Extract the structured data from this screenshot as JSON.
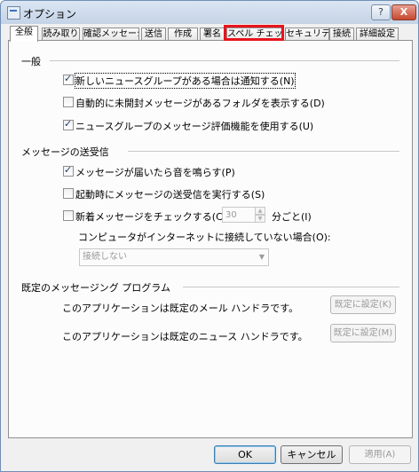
{
  "window": {
    "title": "オプション",
    "help_label": "?",
    "close_label": "X"
  },
  "tabs": [
    {
      "label": "全般"
    },
    {
      "label": "読み取り"
    },
    {
      "label": "確認メッセージ"
    },
    {
      "label": "送信"
    },
    {
      "label": "作成"
    },
    {
      "label": "署名"
    },
    {
      "label": "スペル チェック"
    },
    {
      "label": "セキュリティ"
    },
    {
      "label": "接続"
    },
    {
      "label": "詳細設定"
    }
  ],
  "general": {
    "heading": "一般",
    "options": [
      {
        "label": "新しいニュースグループがある場合は通知する(N)",
        "checked": true
      },
      {
        "label": "自動的に未開封メッセージがあるフォルダを表示する(D)",
        "checked": false
      },
      {
        "label": "ニュースグループのメッセージ評価機能を使用する(U)",
        "checked": true
      }
    ]
  },
  "send_receive": {
    "heading": "メッセージの送受信",
    "options": [
      {
        "label": "メッセージが届いたら音を鳴らす(P)",
        "checked": true
      },
      {
        "label": "起動時にメッセージの送受信を実行する(S)",
        "checked": false
      },
      {
        "label": "新着メッセージをチェックする(C)",
        "checked": false
      }
    ],
    "interval_value": "30",
    "interval_unit": "分ごと(I)",
    "offline_label": "コンピュータがインターネットに接続していない場合(O):",
    "offline_select": "接続しない"
  },
  "default_program": {
    "heading": "既定のメッセージング プログラム",
    "mail_text": "このアプリケーションは既定のメール ハンドラです。",
    "mail_button": "既定に設定(K)",
    "news_text": "このアプリケーションは既定のニュース ハンドラです。",
    "news_button": "既定に設定(M)"
  },
  "footer": {
    "ok": "OK",
    "cancel": "キャンセル",
    "apply": "適用(A)"
  }
}
